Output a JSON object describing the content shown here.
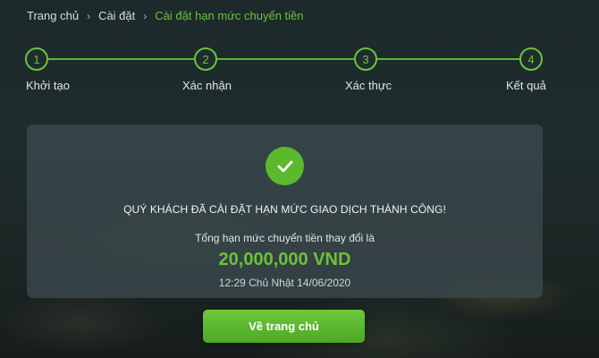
{
  "breadcrumb": {
    "items": [
      "Trang chủ",
      "Cài đặt"
    ],
    "current": "Cài đặt hạn mức chuyển tiền",
    "separator": "›"
  },
  "stepper": {
    "steps": [
      {
        "number": "1",
        "label": "Khởi tạo"
      },
      {
        "number": "2",
        "label": "Xác nhận"
      },
      {
        "number": "3",
        "label": "Xác thực"
      },
      {
        "number": "4",
        "label": "Kết quả"
      }
    ],
    "active_color": "#6cc23a"
  },
  "result": {
    "icon": "check-icon",
    "message": "QUÝ KHÁCH ĐÃ CÀI ĐẶT HẠN MỨC GIAO DỊCH THÀNH CÔNG!",
    "subtitle": "Tổng hạn mức chuyển tiền thay đổi là",
    "amount": "20,000,000 VND",
    "timestamp": "12:29 Chủ Nhật 14/06/2020"
  },
  "actions": {
    "home_label": "Về trang chủ"
  },
  "colors": {
    "accent": "#6cc23a",
    "card_bg": "#3a484c"
  }
}
